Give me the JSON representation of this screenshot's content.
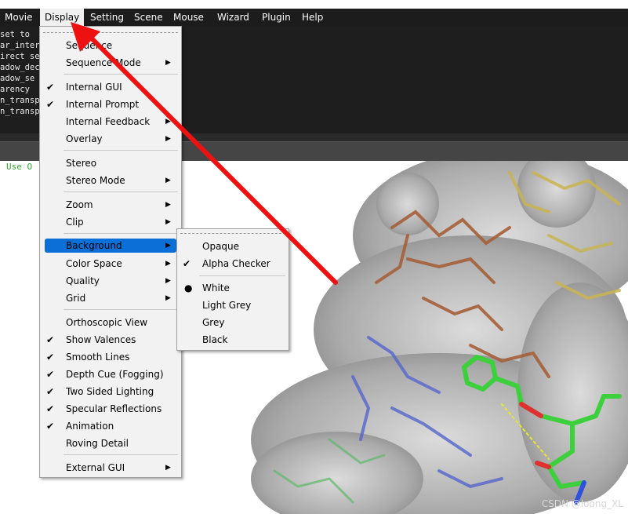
{
  "menubar": {
    "items": [
      "Movie",
      "Display",
      "Setting",
      "Scene",
      "Mouse",
      "Wizard",
      "Plugin",
      "Help"
    ],
    "open_item": "Display"
  },
  "console": {
    "lines": [
      "set to",
      "ar_inter",
      "irect se",
      "adow_dec",
      "adow_se",
      "arency",
      "n_transp",
      "n_transp"
    ]
  },
  "viewport": {
    "note": "Use O",
    "watermark": "CSDN @loong_XL"
  },
  "display_menu": {
    "items": [
      {
        "label": "Sequence",
        "checked": false,
        "submenu": false
      },
      {
        "label": "Sequence Mode",
        "checked": false,
        "submenu": true
      },
      {
        "label": "Internal GUI",
        "checked": true,
        "submenu": false
      },
      {
        "label": "Internal Prompt",
        "checked": true,
        "submenu": false
      },
      {
        "label": "Internal Feedback",
        "checked": false,
        "submenu": true
      },
      {
        "label": "Overlay",
        "checked": false,
        "submenu": true
      },
      {
        "label": "Stereo",
        "checked": false,
        "submenu": false
      },
      {
        "label": "Stereo Mode",
        "checked": false,
        "submenu": true
      },
      {
        "label": "Zoom",
        "checked": false,
        "submenu": true
      },
      {
        "label": "Clip",
        "checked": false,
        "submenu": true
      },
      {
        "label": "Background",
        "checked": false,
        "submenu": true,
        "highlighted": true
      },
      {
        "label": "Color Space",
        "checked": false,
        "submenu": true
      },
      {
        "label": "Quality",
        "checked": false,
        "submenu": true
      },
      {
        "label": "Grid",
        "checked": false,
        "submenu": true
      },
      {
        "label": "Orthoscopic View",
        "checked": false,
        "submenu": false
      },
      {
        "label": "Show Valences",
        "checked": true,
        "submenu": false
      },
      {
        "label": "Smooth Lines",
        "checked": true,
        "submenu": false
      },
      {
        "label": "Depth Cue (Fogging)",
        "checked": true,
        "submenu": false
      },
      {
        "label": "Two Sided Lighting",
        "checked": true,
        "submenu": false
      },
      {
        "label": "Specular Reflections",
        "checked": true,
        "submenu": false
      },
      {
        "label": "Animation",
        "checked": true,
        "submenu": false
      },
      {
        "label": "Roving Detail",
        "checked": false,
        "submenu": false
      },
      {
        "label": "External GUI",
        "checked": false,
        "submenu": true
      }
    ]
  },
  "background_menu": {
    "items": [
      {
        "label": "Opaque",
        "mark": ""
      },
      {
        "label": "Alpha Checker",
        "mark": "check"
      },
      {
        "label": "White",
        "mark": "radio"
      },
      {
        "label": "Light Grey",
        "mark": ""
      },
      {
        "label": "Grey",
        "mark": ""
      },
      {
        "label": "Black",
        "mark": ""
      }
    ]
  },
  "colors": {
    "menubar_bg": "#1c1c1c",
    "highlight": "#0a6fd6",
    "arrow": "#ee1111",
    "ligand_green": "#3cd03c"
  }
}
